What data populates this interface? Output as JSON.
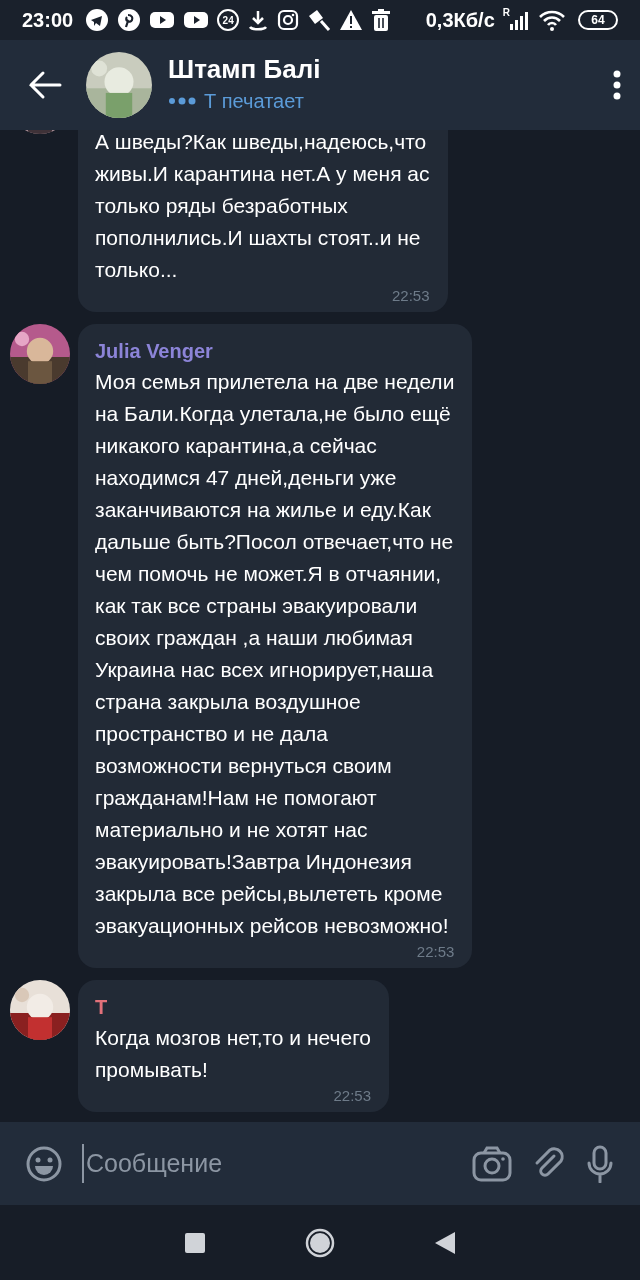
{
  "status_bar": {
    "time": "23:00",
    "notification_badge": "24",
    "network_speed": "0,3Кб/с",
    "signal_label": "R",
    "battery": "64"
  },
  "header": {
    "title": "Штамп Балі",
    "typing_status": "Т печатает"
  },
  "messages": [
    {
      "text": "А шведы?Как шведы,надеюсь,что\nживы.И карантина нет.А у меня ас\nтолько ряды безработных\nпополнились.И шахты стоят..и не\nтолько...",
      "time": "22:53"
    },
    {
      "sender": "Julia Venger",
      "color": "#8c84d8",
      "text": "Моя семья прилетела на две недели\nна Бали.Когда улетала,не было ещё\nникакого карантина,а сейчас\nнаходимся 47 дней,деньги уже\nзаканчиваются на жилье и еду.Как\nдальше быть?Посол отвечает,что не\nчем помочь не может.Я в отчаянии,\nкак так все страны эвакуировали\nсвоих граждан ,а наши любимая\nУкраина нас всех игнорирует,наша\nстрана закрыла воздушное\nпространство и не дала\nвозможности вернуться своим\nгражданам!Нам не помогают\nматериально и не хотят нас\nэвакуировать!Завтра Индонезия\nзакрыла все рейсы,вылететь кроме\nэвакуационных рейсов невозможно!",
      "time": "22:53"
    },
    {
      "sender": "Т",
      "color": "#e2717a",
      "text": "Когда мозгов нет,то и нечего\nпромывать!",
      "time": "22:53"
    }
  ],
  "input": {
    "placeholder": "Сообщение"
  }
}
